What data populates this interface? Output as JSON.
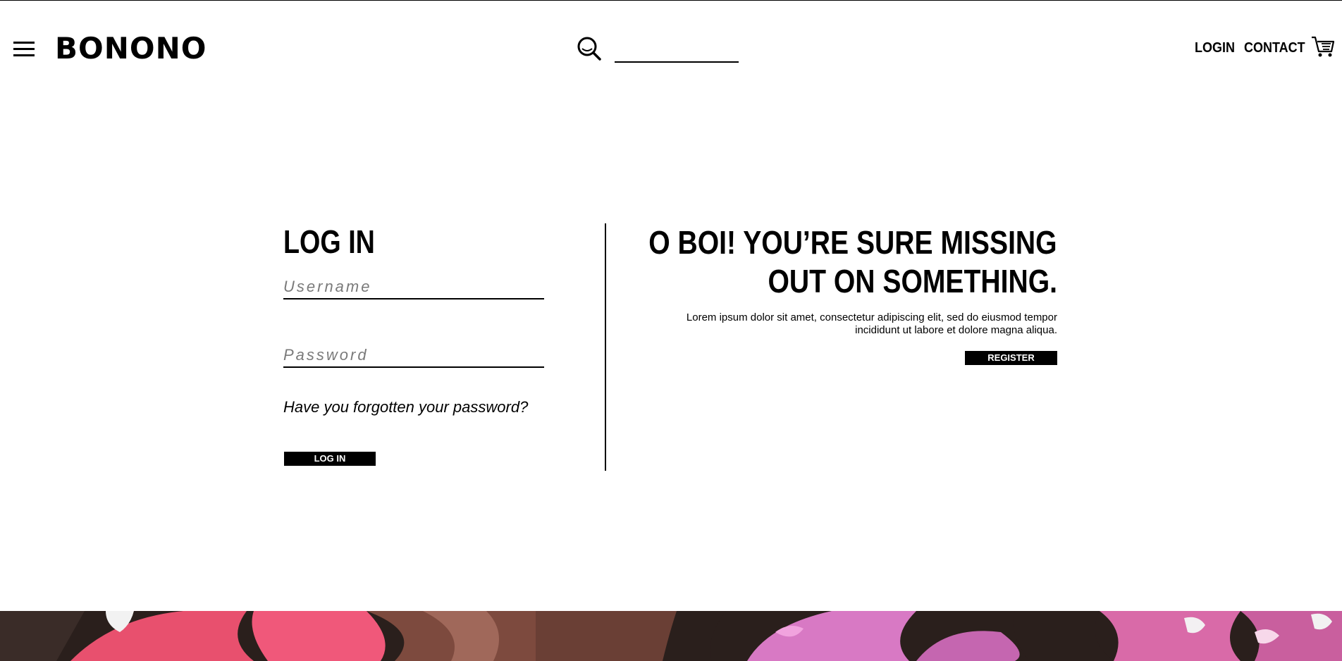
{
  "header": {
    "logo": "BONONO",
    "search": {
      "value": "",
      "placeholder": ""
    },
    "nav": {
      "login": "LOGIN",
      "contact": "CONTACT"
    },
    "icons": {
      "menu": "menu-icon",
      "search": "search-icon",
      "cart": "cart-icon"
    }
  },
  "login": {
    "title": "LOG IN",
    "username_placeholder": "Username",
    "password_placeholder": "Password",
    "forgot_link": "Have you forgotten your password?",
    "button": "LOG IN"
  },
  "register": {
    "title_line1": "O BOI! YOU’RE SURE MISSING",
    "title_line2": "OUT ON SOMETHING.",
    "text": "Lorem ipsum dolor sit amet, consectetur adipiscing elit, sed do eiusmod tempor incididunt ut labore et dolore magna aliqua.",
    "button": "REGISTER"
  },
  "colors": {
    "background": "#ffffff",
    "text": "#000000",
    "placeholder": "#7a7a7a",
    "image_pink": "#e8506e",
    "image_dark": "#2a1f1c",
    "image_lilac": "#d879c4"
  }
}
